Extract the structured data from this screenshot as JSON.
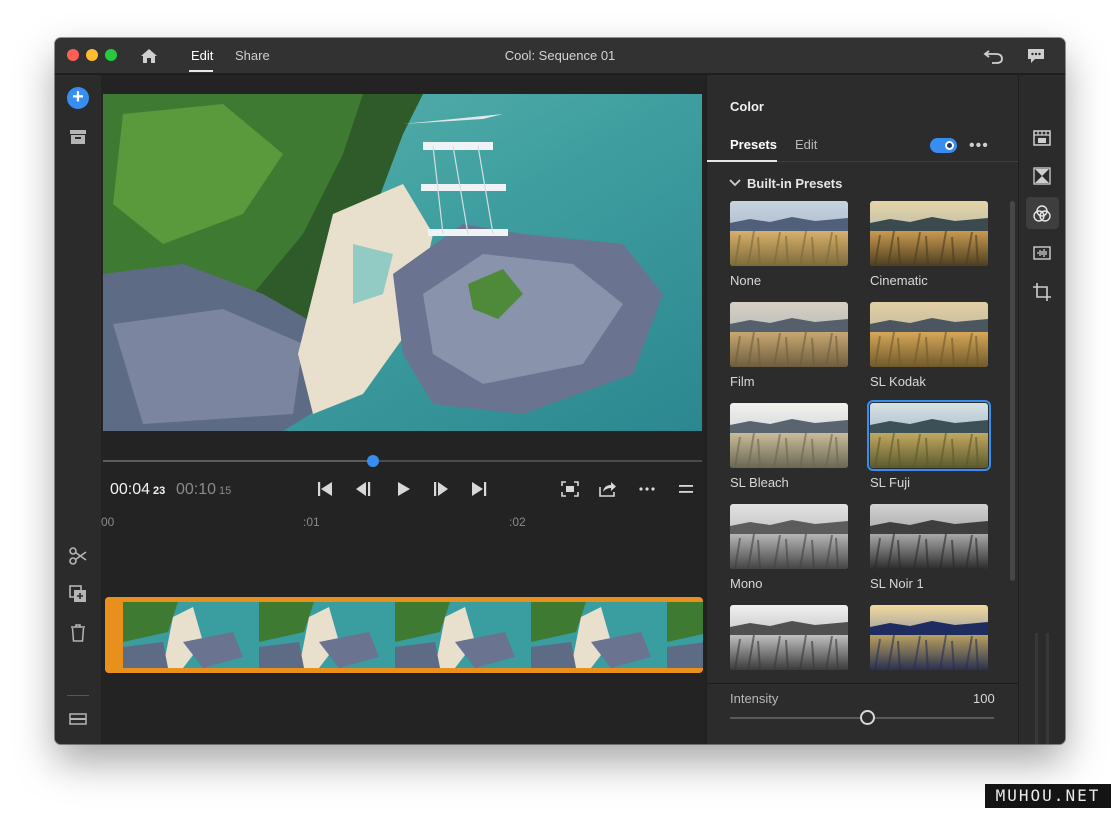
{
  "window": {
    "title": "Cool: Sequence 01",
    "tabs": [
      "Edit",
      "Share"
    ],
    "active_tab": "Edit"
  },
  "player": {
    "current_time": "00:04",
    "current_frames": "23",
    "total_time": "00:10",
    "total_frames": "15",
    "playhead_fraction": 0.45,
    "ruler_labels": [
      "00",
      ":01",
      ":02"
    ]
  },
  "color_panel": {
    "title": "Color",
    "tabs": [
      "Presets",
      "Edit"
    ],
    "active_tab": "Presets",
    "toggle_on": true,
    "more_label": "•••",
    "section_title": "Built-in Presets",
    "presets": [
      {
        "name": "None",
        "style": "none"
      },
      {
        "name": "Cinematic",
        "style": "cinematic"
      },
      {
        "name": "Film",
        "style": "film"
      },
      {
        "name": "SL Kodak",
        "style": "kodak"
      },
      {
        "name": "SL Bleach",
        "style": "bleach"
      },
      {
        "name": "SL Fuji",
        "style": "fuji",
        "selected": true
      },
      {
        "name": "Mono",
        "style": "mono"
      },
      {
        "name": "SL Noir 1",
        "style": "noir"
      },
      {
        "name": "",
        "style": "mono2"
      },
      {
        "name": "",
        "style": "blue"
      }
    ],
    "intensity_label": "Intensity",
    "intensity_value": "100",
    "intensity_fraction": 0.52
  },
  "colors": {
    "accent": "#378ef0",
    "clip": "#e88f1c",
    "background": "#232323"
  },
  "watermark": "MUHOU.NET"
}
